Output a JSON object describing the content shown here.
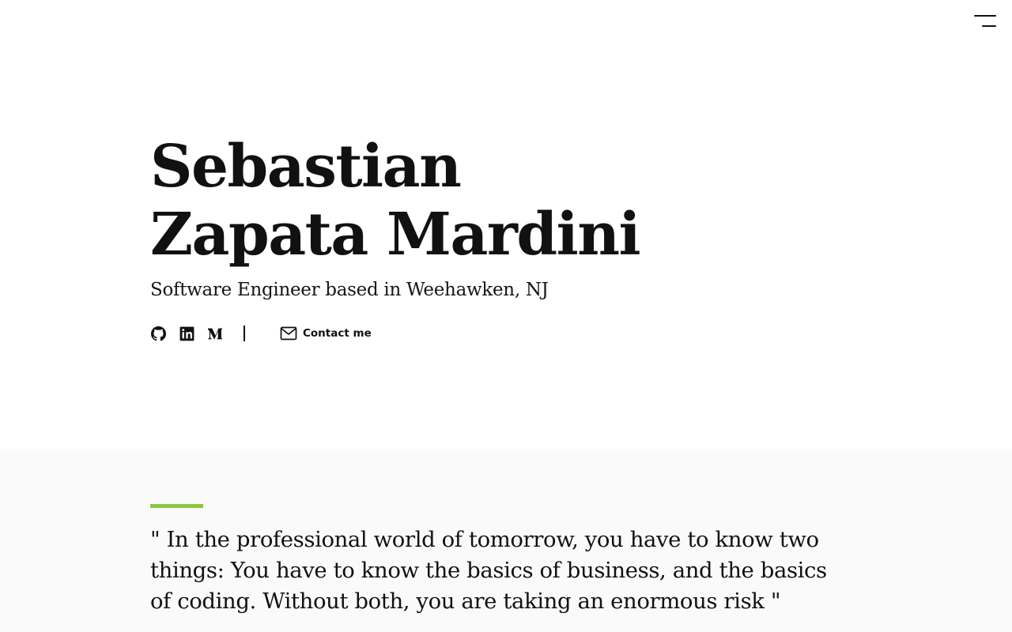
{
  "header": {
    "menu_icon": "hamburger-menu-icon"
  },
  "hero": {
    "name_line1": "Sebastian",
    "name_line2": "Zapata Mardini",
    "tagline": "Software Engineer based in Weehawken, NJ"
  },
  "social": {
    "icons": [
      "github-icon",
      "linkedin-icon",
      "medium-icon"
    ],
    "contact_label": "Contact me",
    "contact_icon": "envelope-icon"
  },
  "quote": {
    "text": "\" In the professional world of tomorrow, you have to know two things: You have to know the basics of business, and the basics of coding. Without both, you are taking an enormous risk \""
  },
  "colors": {
    "accent": "#8dc63f",
    "quote_background": "#fafafa",
    "text": "#111111"
  }
}
